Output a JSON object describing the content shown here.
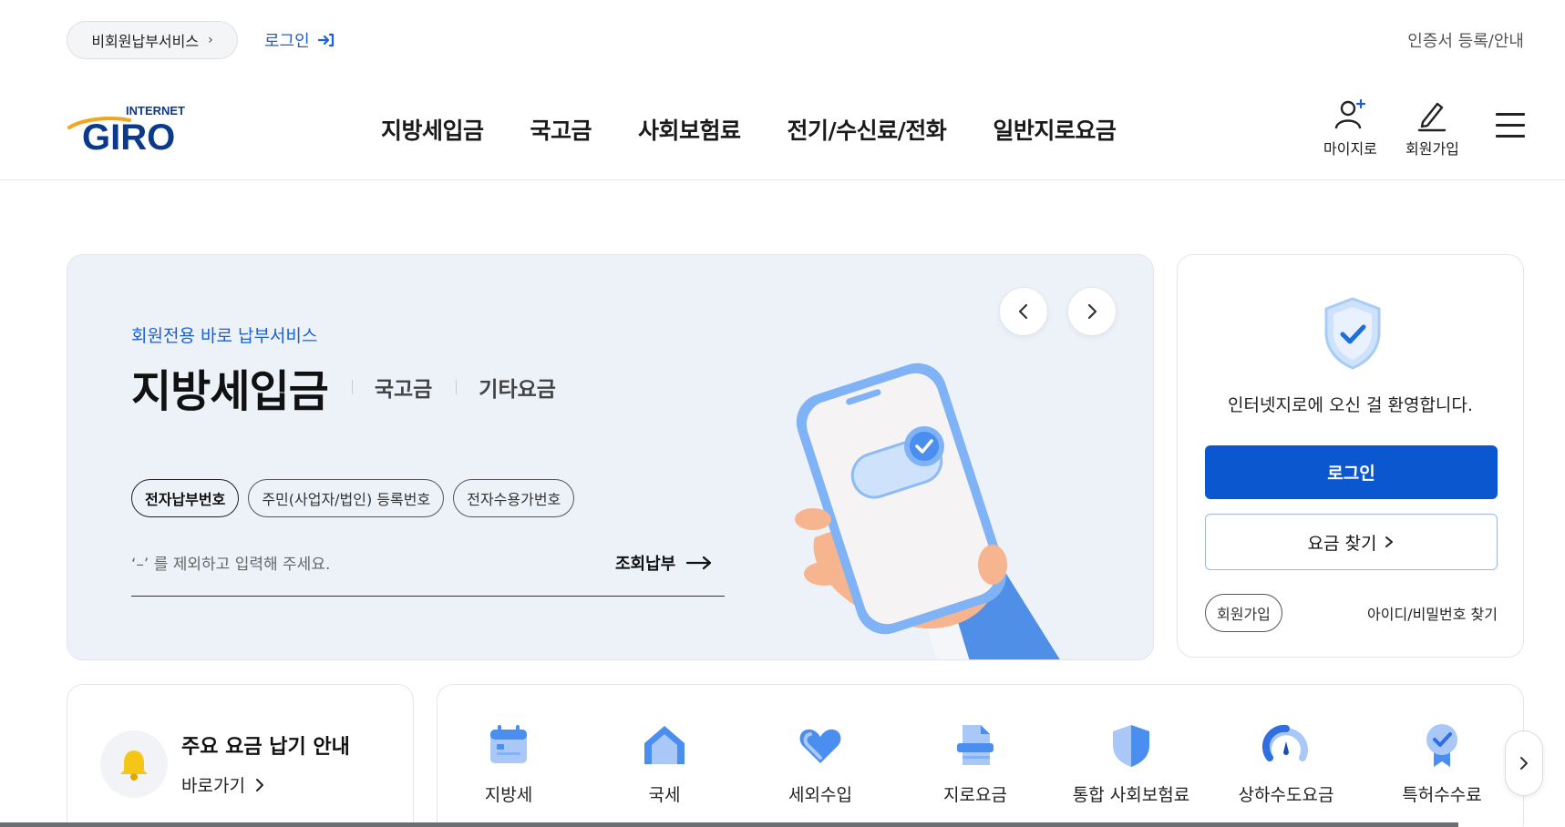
{
  "utility": {
    "nonmember_service": "비회원납부서비스",
    "login": "로그인",
    "certificate": "인증서 등록/안내"
  },
  "header": {
    "logo_top": "INTERNET",
    "logo_main": "GIRO",
    "nav": [
      "지방세입금",
      "국고금",
      "사회보험료",
      "전기/수신료/전화",
      "일반지로요금"
    ],
    "my_giro": "마이지로",
    "signup": "회원가입"
  },
  "hero": {
    "subtitle": "회원전용 바로 납부서비스",
    "tabs": [
      "지방세입금",
      "국고금",
      "기타요금"
    ],
    "chips": [
      "전자납부번호",
      "주민(사업자/법인) 등록번호",
      "전자수용가번호"
    ],
    "input_placeholder": "‘–’ 를 제외하고 입력해 주세요.",
    "submit": "조회납부"
  },
  "login_card": {
    "welcome": "인터넷지로에 오신 걸 환영합니다.",
    "login_button": "로그인",
    "find_fee_button": "요금 찾기",
    "signup": "회원가입",
    "find_id_pw": "아이디/비밀번호 찾기"
  },
  "notice": {
    "title": "주요 요금 납기 안내",
    "link": "바로가기"
  },
  "categories": [
    {
      "label": "지방세",
      "icon": "calendar-icon"
    },
    {
      "label": "국세",
      "icon": "home-icon"
    },
    {
      "label": "세외수입",
      "icon": "heart-icon"
    },
    {
      "label": "지로요금",
      "icon": "document-icon"
    },
    {
      "label": "통합 사회보험료",
      "icon": "shield-icon"
    },
    {
      "label": "상하수도요금",
      "icon": "gauge-icon"
    },
    {
      "label": "특허수수료",
      "icon": "award-icon"
    }
  ],
  "colors": {
    "primary": "#0b57d0",
    "accent_text": "#1a5fd6",
    "hero_bg": "#edf2f9"
  }
}
